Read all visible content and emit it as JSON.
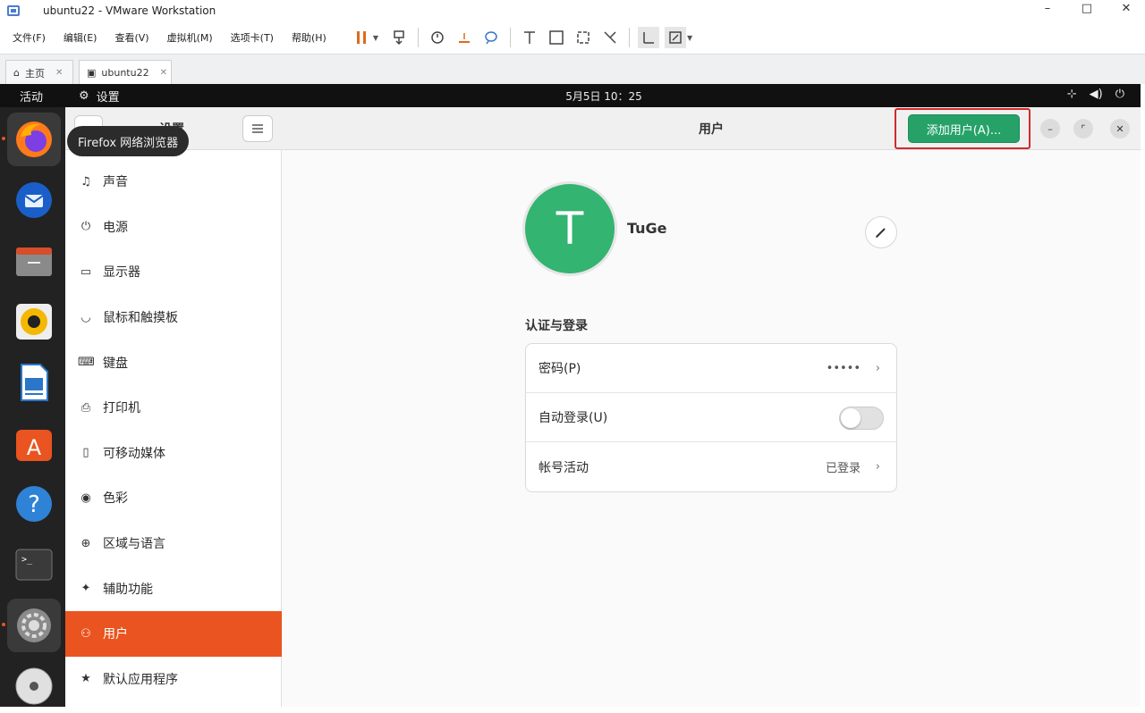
{
  "vmware": {
    "title": "ubuntu22 - VMware Workstation",
    "window_controls": [
      "–",
      "□",
      "✕"
    ],
    "menus": [
      "文件(F)",
      "编辑(E)",
      "查看(V)",
      "虚拟机(M)",
      "选项卡(T)",
      "帮助(H)"
    ],
    "tabs": [
      {
        "label": "主页",
        "icon": "home-icon"
      },
      {
        "label": "ubuntu22",
        "icon": "vm-icon"
      }
    ]
  },
  "topbar": {
    "activities": "活动",
    "app_menu": "设置",
    "clock": "5月5日  10：25"
  },
  "tooltip": "Firefox 网络浏览器",
  "dock": {
    "items": [
      "firefox",
      "thunderbird",
      "files",
      "rhythmbox",
      "libreoffice-writer",
      "app-center",
      "help",
      "terminal",
      "settings",
      "dvd"
    ]
  },
  "sidebar": {
    "title": "设置",
    "items": [
      {
        "label": "声音",
        "icon": "♫"
      },
      {
        "label": "电源",
        "icon": "⏻"
      },
      {
        "label": "显示器",
        "icon": "▭"
      },
      {
        "label": "鼠标和触摸板",
        "icon": "◡"
      },
      {
        "label": "键盘",
        "icon": "⌨"
      },
      {
        "label": "打印机",
        "icon": "⎙"
      },
      {
        "label": "可移动媒体",
        "icon": "▯"
      },
      {
        "label": "色彩",
        "icon": "◉"
      },
      {
        "label": "区域与语言",
        "icon": "⊕"
      },
      {
        "label": "辅助功能",
        "icon": "✦"
      },
      {
        "label": "用户",
        "icon": "⚇"
      },
      {
        "label": "默认应用程序",
        "icon": "★"
      }
    ],
    "selected_index": 10
  },
  "header": {
    "title": "用户",
    "add_user_label": "添加用户(A)...",
    "accent": "#26a269"
  },
  "user": {
    "avatar_letter": "T",
    "avatar_color": "#33b470",
    "name": "TuGe"
  },
  "auth": {
    "section_title": "认证与登录",
    "password_label": "密码(P)",
    "password_value": "•••••",
    "autologin_label": "自动登录(U)",
    "autologin_on": false,
    "activity_label": "帐号活动",
    "activity_value": "已登录"
  }
}
